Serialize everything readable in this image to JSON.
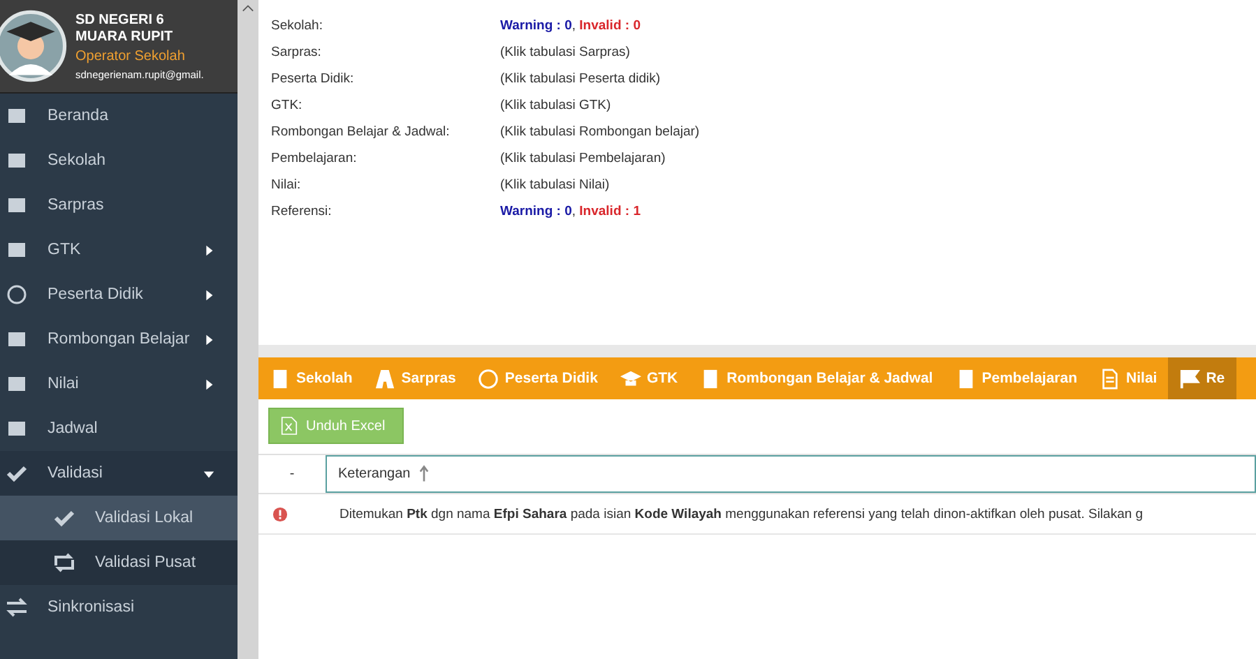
{
  "profile": {
    "school": "SD NEGERI 6 MUARA RUPIT",
    "role": "Operator Sekolah",
    "email": "sdnegerienam.rupit@gmail."
  },
  "sidebar": {
    "items": [
      {
        "label": "Beranda"
      },
      {
        "label": "Sekolah"
      },
      {
        "label": "Sarpras"
      },
      {
        "label": "GTK",
        "expanded": false
      },
      {
        "label": "Peserta Didik",
        "expanded": false
      },
      {
        "label": "Rombongan Belajar",
        "expanded": false
      },
      {
        "label": "Nilai",
        "expanded": false
      },
      {
        "label": "Jadwal"
      },
      {
        "label": "Validasi",
        "expanded": true,
        "children": [
          {
            "label": "Validasi Lokal",
            "selected": true
          },
          {
            "label": "Validasi Pusat",
            "selected": false
          }
        ]
      },
      {
        "label": "Sinkronisasi"
      }
    ]
  },
  "summary": [
    {
      "label": "Sekolah:",
      "value": [
        {
          "kind": "warning",
          "text": "Warning : 0"
        },
        {
          "kind": "plain",
          "text": ","
        },
        {
          "kind": "invalid",
          "text": "Invalid : 0"
        }
      ]
    },
    {
      "label": "Sarpras:",
      "value": [
        {
          "kind": "plain",
          "text": "(Klik tabulasi Sarpras)"
        }
      ]
    },
    {
      "label": "Peserta Didik:",
      "value": [
        {
          "kind": "plain",
          "text": "(Klik tabulasi Peserta didik)"
        }
      ]
    },
    {
      "label": "GTK:",
      "value": [
        {
          "kind": "plain",
          "text": "(Klik tabulasi GTK)"
        }
      ]
    },
    {
      "label": "Rombongan Belajar & Jadwal:",
      "value": [
        {
          "kind": "plain",
          "text": "(Klik tabulasi Rombongan belajar)"
        }
      ]
    },
    {
      "label": "Pembelajaran:",
      "value": [
        {
          "kind": "plain",
          "text": "(Klik tabulasi Pembelajaran)"
        }
      ]
    },
    {
      "label": "Nilai:",
      "value": [
        {
          "kind": "plain",
          "text": "(Klik tabulasi Nilai)"
        }
      ]
    },
    {
      "label": "Referensi:",
      "value": [
        {
          "kind": "warning",
          "text": "Warning : 0"
        },
        {
          "kind": "plain",
          "text": ","
        },
        {
          "kind": "invalid",
          "text": "Invalid : 1"
        }
      ]
    }
  ],
  "tabs": [
    {
      "label": "Sekolah",
      "selected": false
    },
    {
      "label": "Sarpras",
      "selected": false
    },
    {
      "label": "Peserta Didik",
      "selected": false
    },
    {
      "label": "GTK",
      "selected": false
    },
    {
      "label": "Rombongan Belajar & Jadwal",
      "selected": false
    },
    {
      "label": "Pembelajaran",
      "selected": false
    },
    {
      "label": "Nilai",
      "selected": false
    },
    {
      "label": "Re",
      "selected": true
    }
  ],
  "toolbar": {
    "button": "Unduh Excel"
  },
  "table": {
    "columns": [
      "-",
      "Keterangan"
    ],
    "rows": [
      {
        "message": "Ditemukan **Ptk** dgn nama **Efpi Sahara** pada isian **Kode Wilayah** menggunakan referensi yang telah dinon-aktifkan oleh pusat. Silakan g"
      }
    ]
  }
}
